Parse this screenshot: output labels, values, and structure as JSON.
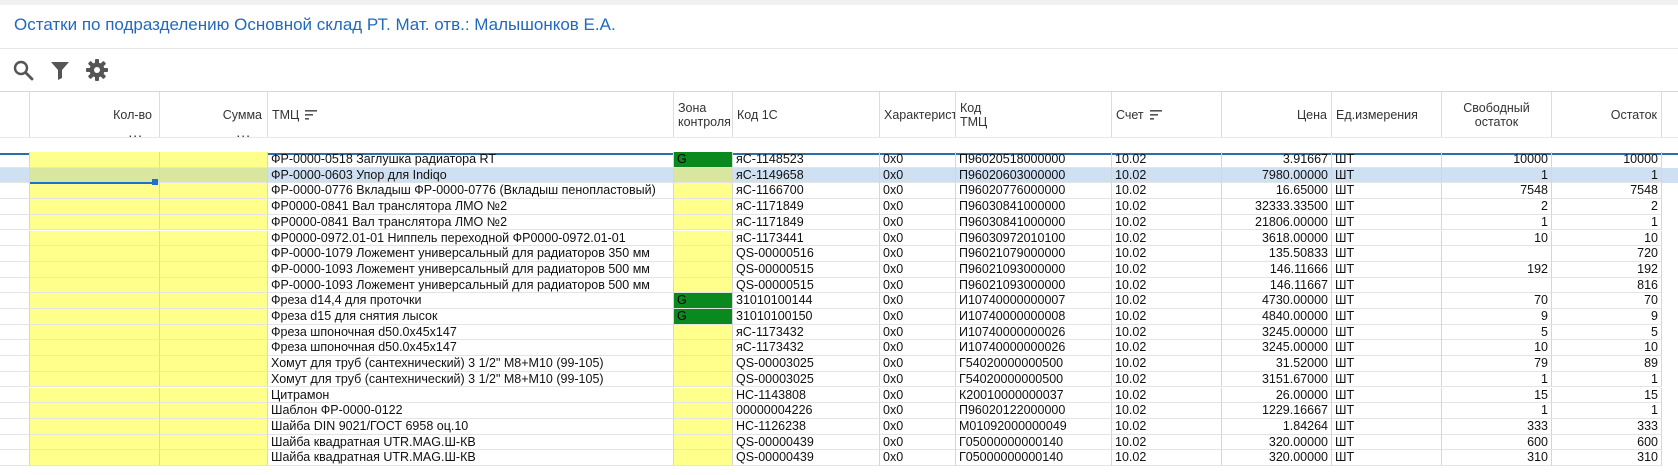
{
  "title": "Остатки по подразделению Основной склад РТ. Мат. отв.: Малышонков Е.А.",
  "toolbar": {
    "icons": [
      "search-icon",
      "filter-icon",
      "gear-icon"
    ]
  },
  "columns": {
    "qty": "Кол-во",
    "sum": "Сумма",
    "tmc": "ТМЦ",
    "zone_line1": "Зона",
    "zone_line2": "контроля",
    "code1c": "Код 1С",
    "char": "Характеристика",
    "code_tmc_line1": "Код",
    "code_tmc_line2": "ТМЦ",
    "account": "Счет",
    "price": "Цена",
    "unit": "Ед.измерения",
    "free_line1": "Свободный",
    "free_line2": "остаток",
    "rest": "Остаток",
    "dots": "..."
  },
  "colors": {
    "title": "#1f69c0",
    "yellow": "#ffff8c",
    "zone_green": "#0a8a1e",
    "selected": "#cfe0f2",
    "accent_line": "#2e6ea7"
  },
  "rows": [
    {
      "tmc": "ФР-0000-0518 Заглушка радиатора RT",
      "zone": "G",
      "code1c": "яС-1148523",
      "char": "0x0",
      "code_tmc": "П96020518000000",
      "account": "10.02",
      "price": "3.91667",
      "unit": "ШТ",
      "free": "10000",
      "rest": "10000"
    },
    {
      "tmc": "ФР-0000-0603 Упор для Indiqo",
      "zone": "",
      "code1c": "яС-1149658",
      "char": "0x0",
      "code_tmc": "П96020603000000",
      "account": "10.02",
      "price": "7980.00000",
      "unit": "ШТ",
      "free": "1",
      "rest": "1"
    },
    {
      "tmc": "ФР-0000-0776 Вкладыш ФР-0000-0776 (Вкладыш пенопластовый)",
      "zone": "",
      "code1c": "яС-1166700",
      "char": "0x0",
      "code_tmc": "П96020776000000",
      "account": "10.02",
      "price": "16.65000",
      "unit": "ШТ",
      "free": "7548",
      "rest": "7548"
    },
    {
      "tmc": "ФР0000-0841 Вал транслятора ЛМО №2",
      "zone": "",
      "code1c": "яС-1171849",
      "char": "0x0",
      "code_tmc": "П96030841000000",
      "account": "10.02",
      "price": "32333.33500",
      "unit": "ШТ",
      "free": "2",
      "rest": "2"
    },
    {
      "tmc": "ФР0000-0841 Вал транслятора ЛМО №2",
      "zone": "",
      "code1c": "яС-1171849",
      "char": "0x0",
      "code_tmc": "П96030841000000",
      "account": "10.02",
      "price": "21806.00000",
      "unit": "ШТ",
      "free": "1",
      "rest": "1"
    },
    {
      "tmc": "ФР0000-0972.01-01 Ниппель переходной  ФР0000-0972.01-01",
      "zone": "",
      "code1c": "яС-1173441",
      "char": "0x0",
      "code_tmc": "П96030972010100",
      "account": "10.02",
      "price": "3618.00000",
      "unit": "ШТ",
      "free": "10",
      "rest": "10"
    },
    {
      "tmc": "ФР-0000-1079 Ложемент универсальный для радиаторов 350 мм",
      "zone": "",
      "code1c": "QS-00000516",
      "char": "0x0",
      "code_tmc": "П96021079000000",
      "account": "10.02",
      "price": "135.50833",
      "unit": "ШТ",
      "free": "",
      "rest": "720"
    },
    {
      "tmc": "ФР-0000-1093 Ложемент универсальный для радиаторов 500 мм",
      "zone": "",
      "code1c": "QS-00000515",
      "char": "0x0",
      "code_tmc": "П96021093000000",
      "account": "10.02",
      "price": "146.11666",
      "unit": "ШТ",
      "free": "192",
      "rest": "192"
    },
    {
      "tmc": "ФР-0000-1093 Ложемент универсальный для радиаторов 500 мм",
      "zone": "",
      "code1c": "QS-00000515",
      "char": "0x0",
      "code_tmc": "П96021093000000",
      "account": "10.02",
      "price": "146.11667",
      "unit": "ШТ",
      "free": "",
      "rest": "816"
    },
    {
      "tmc": "Фреза d14,4 для проточки",
      "zone": "G",
      "code1c": "31010100144",
      "char": "0x0",
      "code_tmc": "И10740000000007",
      "account": "10.02",
      "price": "4730.00000",
      "unit": "ШТ",
      "free": "70",
      "rest": "70"
    },
    {
      "tmc": "Фреза d15 для снятия лысок",
      "zone": "G",
      "code1c": "31010100150",
      "char": "0x0",
      "code_tmc": "И10740000000008",
      "account": "10.02",
      "price": "4840.00000",
      "unit": "ШТ",
      "free": "9",
      "rest": "9"
    },
    {
      "tmc": "Фреза шпоночная d50.0x45x147",
      "zone": "",
      "code1c": "яС-1173432",
      "char": "0x0",
      "code_tmc": "И10740000000026",
      "account": "10.02",
      "price": "3245.00000",
      "unit": "ШТ",
      "free": "5",
      "rest": "5"
    },
    {
      "tmc": "Фреза шпоночная d50.0x45x147",
      "zone": "",
      "code1c": "яС-1173432",
      "char": "0x0",
      "code_tmc": "И10740000000026",
      "account": "10.02",
      "price": "3245.00000",
      "unit": "ШТ",
      "free": "10",
      "rest": "10"
    },
    {
      "tmc": "Хомут для труб (сантехнический) 3 1/2\" М8+М10 (99-105)",
      "zone": "",
      "code1c": "QS-00003025",
      "char": "0x0",
      "code_tmc": "Г54020000000500",
      "account": "10.02",
      "price": "31.52000",
      "unit": "ШТ",
      "free": "79",
      "rest": "89"
    },
    {
      "tmc": "Хомут для труб (сантехнический) 3 1/2\" М8+М10 (99-105)",
      "zone": "",
      "code1c": "QS-00003025",
      "char": "0x0",
      "code_tmc": "Г54020000000500",
      "account": "10.02",
      "price": "3151.67000",
      "unit": "ШТ",
      "free": "1",
      "rest": "1"
    },
    {
      "tmc": "Цитрамон",
      "zone": "",
      "code1c": "НС-1143808",
      "char": "0x0",
      "code_tmc": "К20010000000037",
      "account": "10.02",
      "price": "26.00000",
      "unit": "ШТ",
      "free": "15",
      "rest": "15"
    },
    {
      "tmc": "Шаблон ФР-0000-0122",
      "zone": "",
      "code1c": "00000004226",
      "char": "0x0",
      "code_tmc": "П96020122000000",
      "account": "10.02",
      "price": "1229.16667",
      "unit": "ШТ",
      "free": "1",
      "rest": "1"
    },
    {
      "tmc": "Шайба DIN 9021/ГОСТ 6958 оц.10",
      "zone": "",
      "code1c": "НС-1126238",
      "char": "0x0",
      "code_tmc": "М01092000000049",
      "account": "10.02",
      "price": "1.84264",
      "unit": "ШТ",
      "free": "333",
      "rest": "333"
    },
    {
      "tmc": "Шайба квадратная UTR.MAG.Ш-КВ",
      "zone": "",
      "code1c": "QS-00000439",
      "char": "0x0",
      "code_tmc": "Г05000000000140",
      "account": "10.02",
      "price": "320.00000",
      "unit": "ШТ",
      "free": "600",
      "rest": "600"
    },
    {
      "tmc": "Шайба квадратная UTR.MAG.Ш-КВ",
      "zone": "",
      "code1c": "QS-00000439",
      "char": "0x0",
      "code_tmc": "Г05000000000140",
      "account": "10.02",
      "price": "320.00000",
      "unit": "ШТ",
      "free": "310",
      "rest": "310"
    }
  ]
}
